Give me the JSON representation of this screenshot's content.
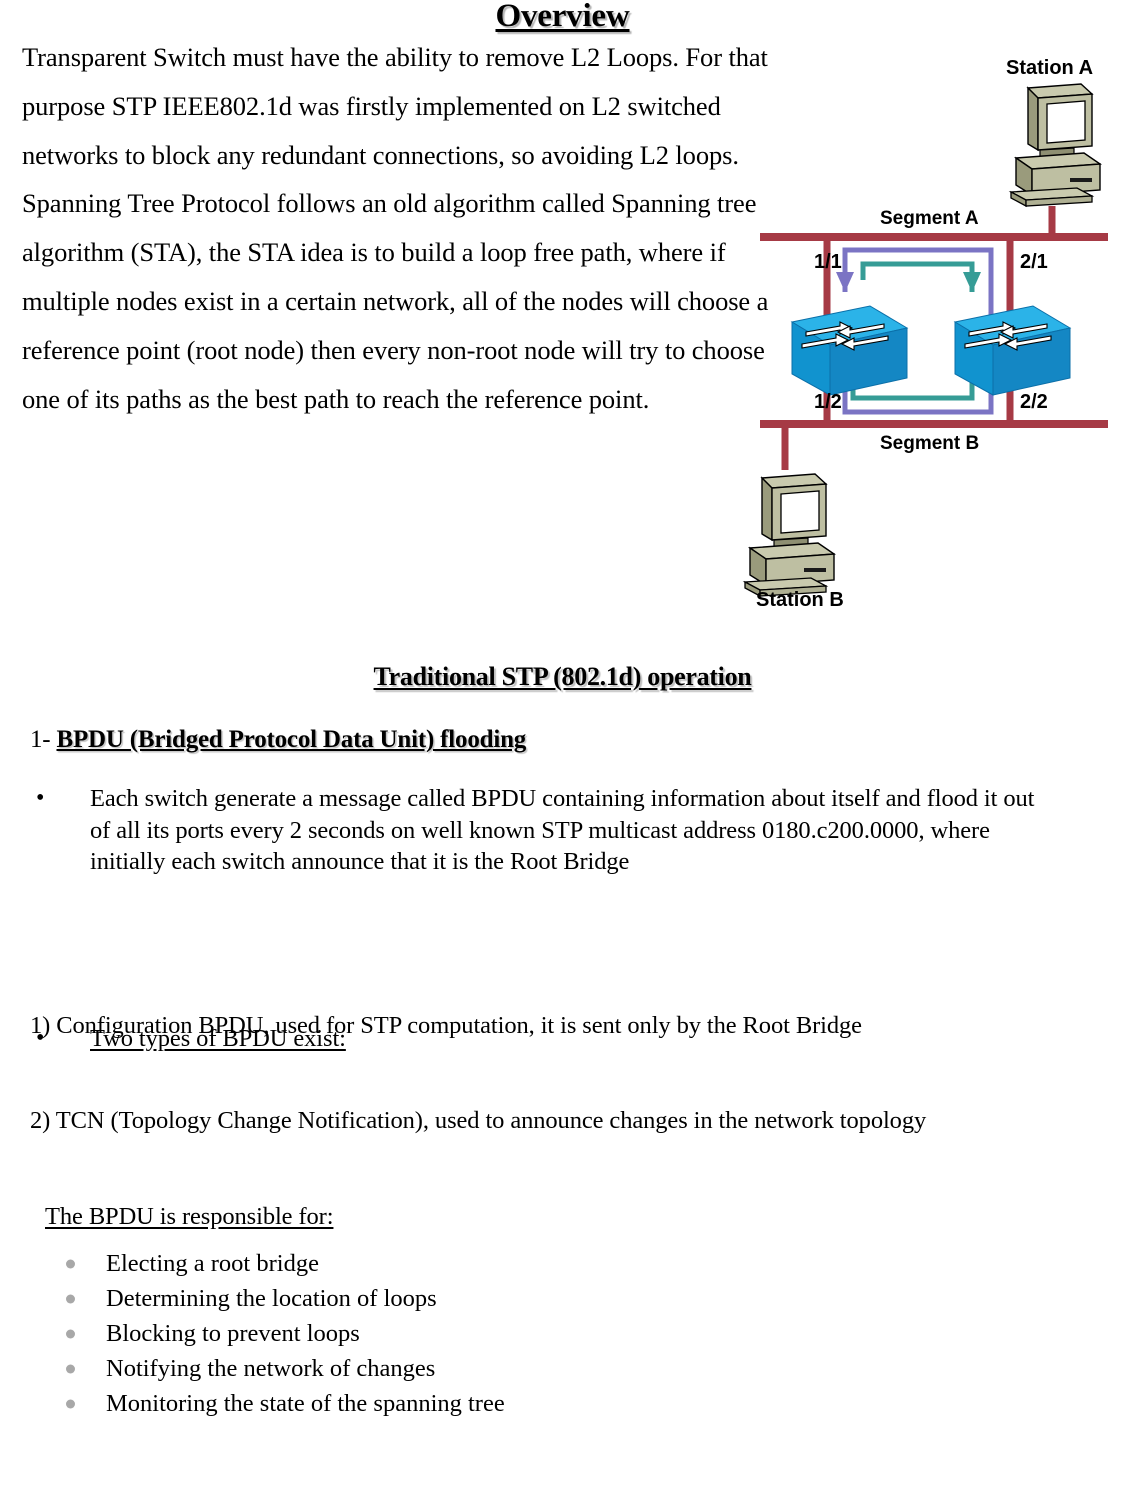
{
  "document": {
    "title": "Overview",
    "intro_paragraph": "Transparent Switch must have the ability to remove L2 Loops. For that purpose STP IEEE802.1d was firstly implemented on L2 switched networks to block any redundant connections, so avoiding L2 loops. Spanning Tree Protocol follows an old algorithm called Spanning tree algorithm (STA), the STA idea is to build  a loop free path, where if multiple nodes exist in a certain network, all of the nodes will choose a reference point (root node)  then every non-root node will try to choose one of its paths as the best path to reach the reference point.",
    "section_title": "Traditional STP (802.1d) operation",
    "heading_prefix": "1- ",
    "heading_text": "BPDU (Bridged Protocol Data Unit) flooding",
    "bullet_marker": "•",
    "bullets": [
      "Each switch generate a message called BPDU containing information about itself and flood it out of all its ports every 2 seconds on well known STP multicast address 0180.c200.0000, where initially each switch announce that it is the Root Bridge",
      "Two types of BPDU exist:"
    ],
    "numbered_items": [
      "1) Configuration BPDU, used for STP computation, it is sent only by the Root Bridge",
      "2) TCN (Topology Change Notification), used to announce changes in the network topology"
    ],
    "responsible_heading": "The BPDU is responsible for:",
    "responsible_items": [
      "Electing a root bridge",
      "Determining the location of loops",
      "Blocking to prevent loops",
      "Notifying the network of changes",
      "Monitoring the state of the spanning tree"
    ]
  },
  "diagram": {
    "labels": {
      "station_a": "Station A",
      "station_b": "Station B",
      "segment_a": "Segment A",
      "segment_b": "Segment B",
      "port_1_1": "1/1",
      "port_2_1": "2/1",
      "port_1_2": "1/2",
      "port_2_2": "2/2"
    },
    "colors": {
      "segment_line": "#A63A45",
      "switch_body": "#1CA0DC",
      "switch_side": "#0F7FBF",
      "path_purple": "#7B74C4",
      "path_teal": "#369C96",
      "station_body": "#B9BA9B",
      "station_shade": "#8E8F72"
    }
  }
}
